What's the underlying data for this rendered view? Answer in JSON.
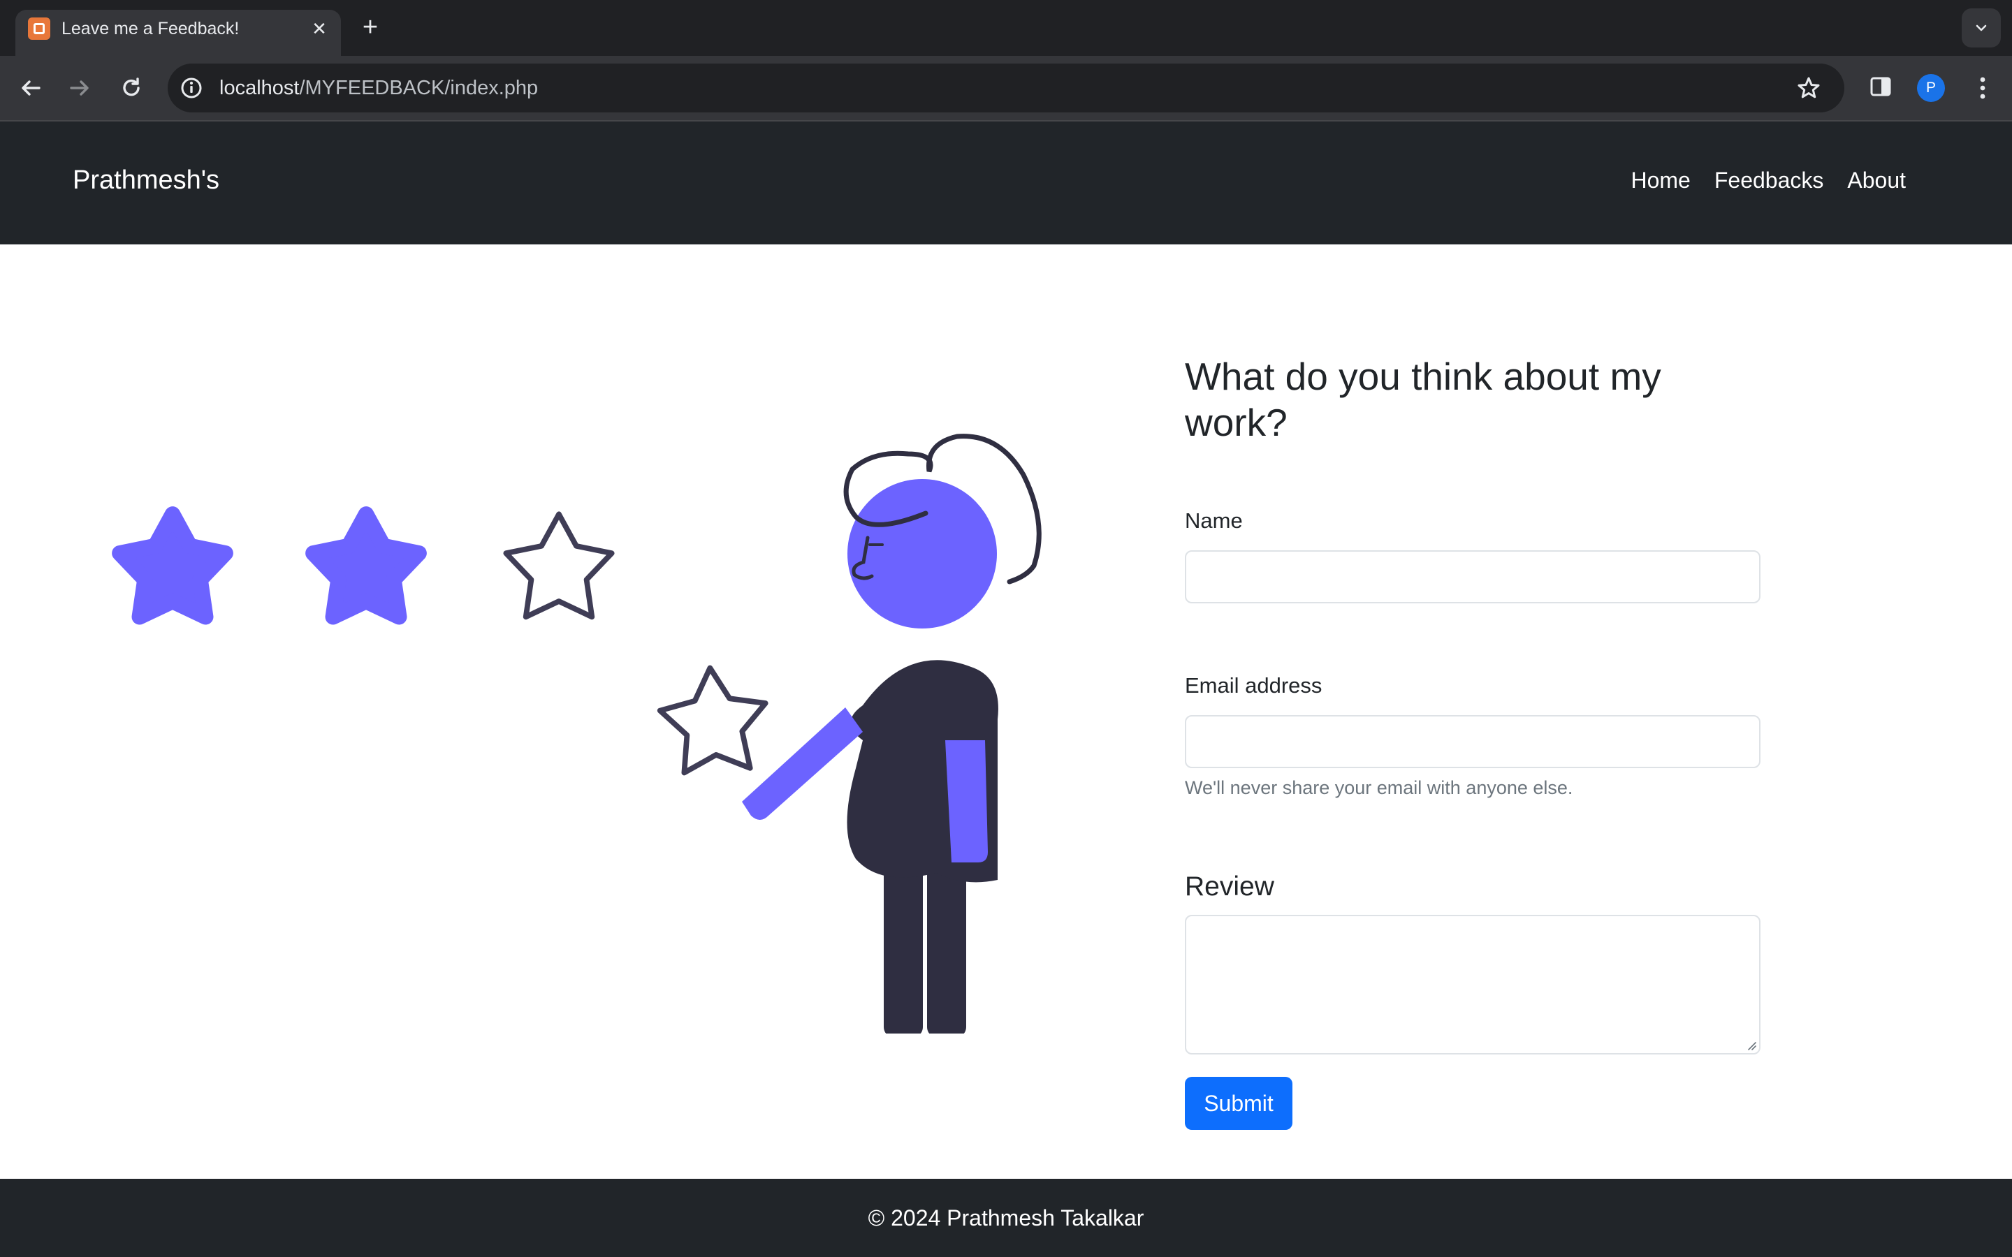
{
  "browser": {
    "tab_title": "Leave me a Feedback!",
    "new_tab": "+",
    "close_tab": "✕",
    "url_host": "localhost",
    "url_path": "/MYFEEDBACK/index.php",
    "profile_initial": "P"
  },
  "navbar": {
    "brand": "Prathmesh's",
    "links": [
      "Home",
      "Feedbacks",
      "About"
    ]
  },
  "illustration": {
    "rating": 2,
    "rating_out_of": 3,
    "colors": {
      "accent": "#6c63ff",
      "dark": "#2f2e41"
    }
  },
  "form": {
    "heading": "What do you think about my work?",
    "name_label": "Name",
    "name_value": "",
    "email_label": "Email address",
    "email_value": "",
    "email_help": "We'll never share your email with anyone else.",
    "review_label": "Review",
    "review_value": "",
    "submit_label": "Submit"
  },
  "footer": {
    "text": "© 2024 Prathmesh Takalkar"
  },
  "colors": {
    "navbar_bg": "#212529",
    "primary": "#0d6efd",
    "accent": "#6c63ff"
  }
}
